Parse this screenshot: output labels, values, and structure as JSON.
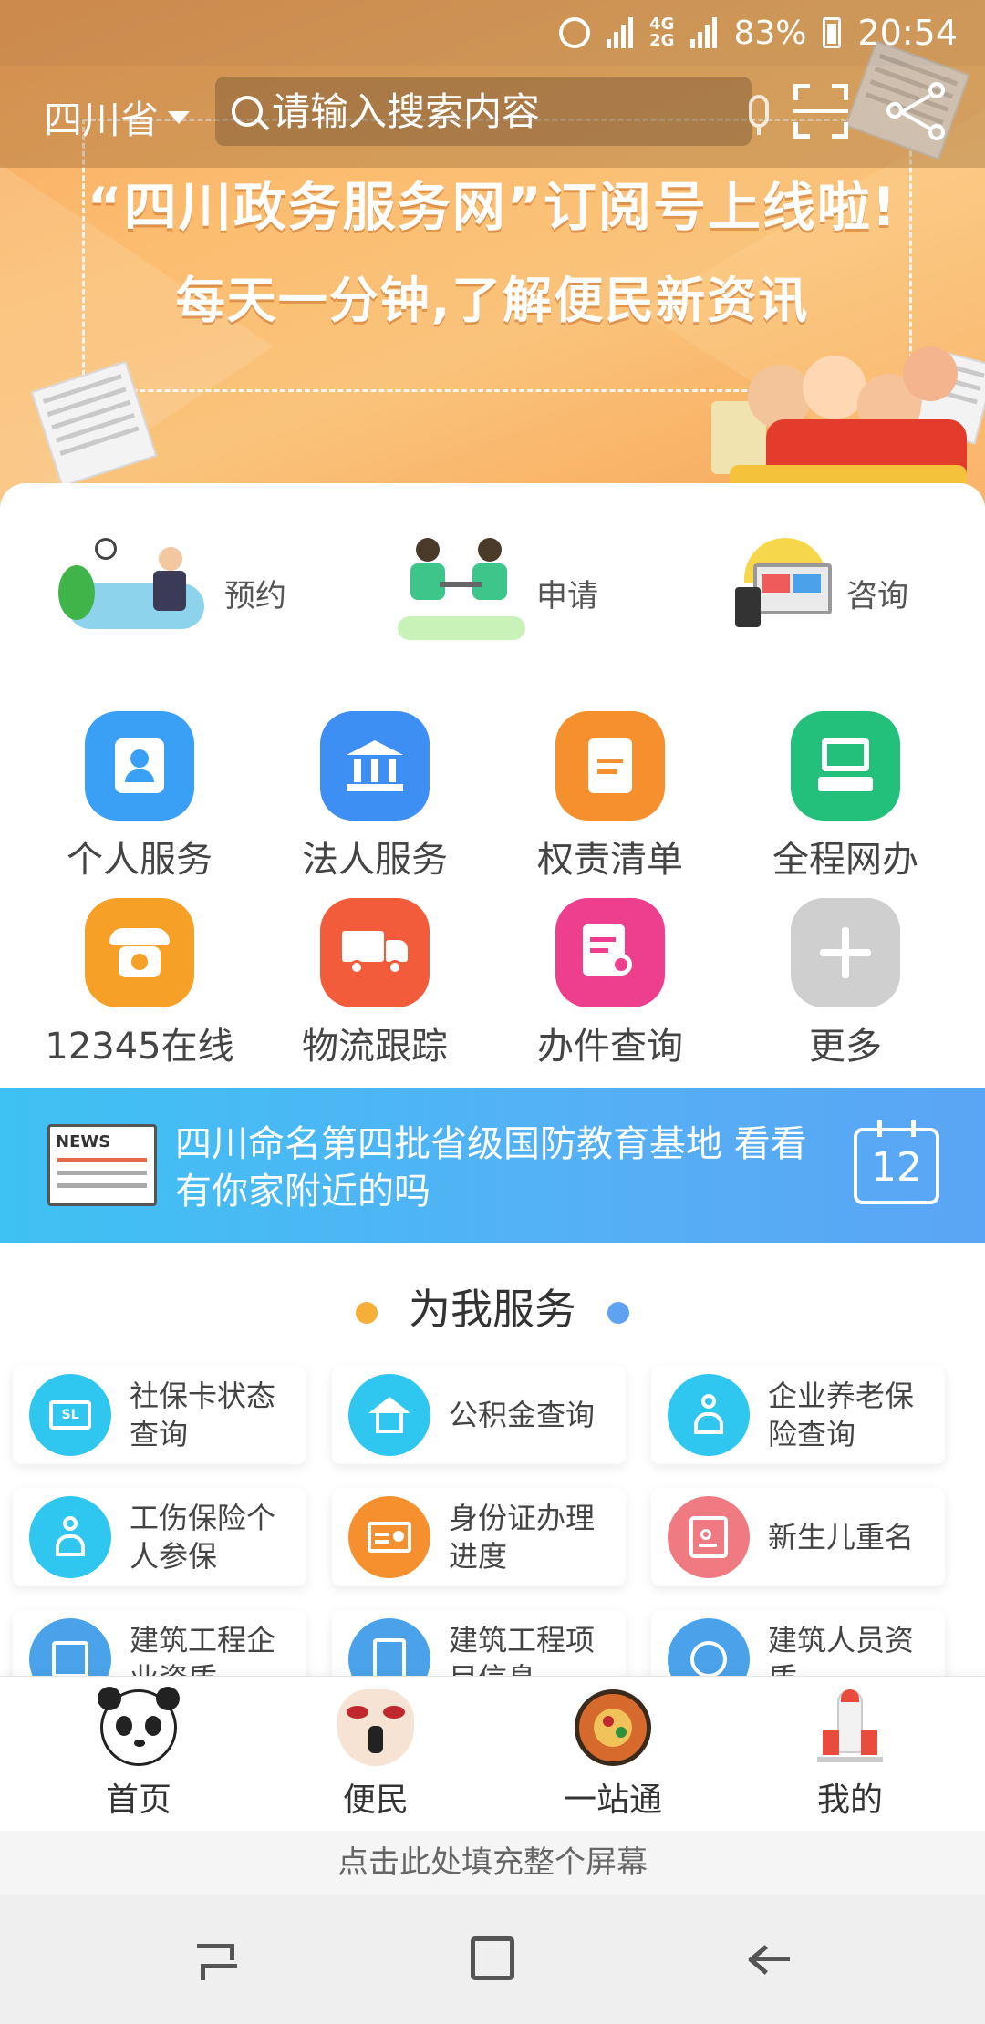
{
  "status_bar": {
    "net_top": "4G",
    "net_bottom": "2G",
    "battery": "83%",
    "time": "20:54"
  },
  "header": {
    "region": "四川省",
    "search_placeholder": "请输入搜索内容"
  },
  "banner": {
    "headline": "“四川政务服务网”订阅号上线啦!",
    "subline": "每天一分钟,了解便民新资讯"
  },
  "quick_entries": [
    {
      "label": "预约",
      "icon": "reception-desk-icon"
    },
    {
      "label": "申请",
      "icon": "meeting-icon"
    },
    {
      "label": "咨询",
      "icon": "computer-screens-icon"
    }
  ],
  "grid": [
    {
      "label": "个人服务",
      "icon": "person-card-icon",
      "color": "#3aa0f5"
    },
    {
      "label": "法人服务",
      "icon": "bank-building-icon",
      "color": "#3d8ff3"
    },
    {
      "label": "权责清单",
      "icon": "document-icon",
      "color": "#f6902f"
    },
    {
      "label": "全程网办",
      "icon": "computer-icon",
      "color": "#22c07a"
    },
    {
      "label": "12345在线",
      "icon": "telephone-icon",
      "color": "#f6a028"
    },
    {
      "label": "物流跟踪",
      "icon": "truck-icon",
      "color": "#f25c3b"
    },
    {
      "label": "办件查询",
      "icon": "doc-search-icon",
      "color": "#ee3f8f"
    },
    {
      "label": "更多",
      "icon": "plus-icon",
      "color": "#cfcfcf"
    }
  ],
  "news": {
    "badge": "NEWS",
    "text": "四川命名第四批省级国防教育基地 看看有你家附近的吗",
    "day": "12"
  },
  "services_title": "为我服务",
  "services": [
    {
      "label": "社保卡状态查询",
      "icon": "sl-card-icon",
      "color": "#2fc6f0"
    },
    {
      "label": "公积金查询",
      "icon": "house-icon",
      "color": "#2fc6f0"
    },
    {
      "label": "企业养老保险查询",
      "icon": "elderly-icon",
      "color": "#2fc6f0"
    },
    {
      "label": "工伤保险个人参保",
      "icon": "injured-person-icon",
      "color": "#2fc6f0"
    },
    {
      "label": "身份证办理进度",
      "icon": "id-card-icon",
      "color": "#f6902f"
    },
    {
      "label": "新生儿重名",
      "icon": "name-search-icon",
      "color": "#f07a82"
    },
    {
      "label": "建筑工程企业资质",
      "icon": "edit-icon",
      "color": "#4aa3ea"
    },
    {
      "label": "建筑工程项目信息",
      "icon": "clipboard-icon",
      "color": "#4aa3ea"
    },
    {
      "label": "建筑人员资质",
      "icon": "badge-icon",
      "color": "#4aa3ea"
    }
  ],
  "bottom_nav": [
    {
      "label": "首页",
      "icon": "panda-icon"
    },
    {
      "label": "便民",
      "icon": "opera-mask-icon"
    },
    {
      "label": "一站通",
      "icon": "pizza-plate-icon"
    },
    {
      "label": "我的",
      "icon": "rocket-icon"
    }
  ],
  "fill_screen_prompt": "点击此处填充整个屏幕"
}
